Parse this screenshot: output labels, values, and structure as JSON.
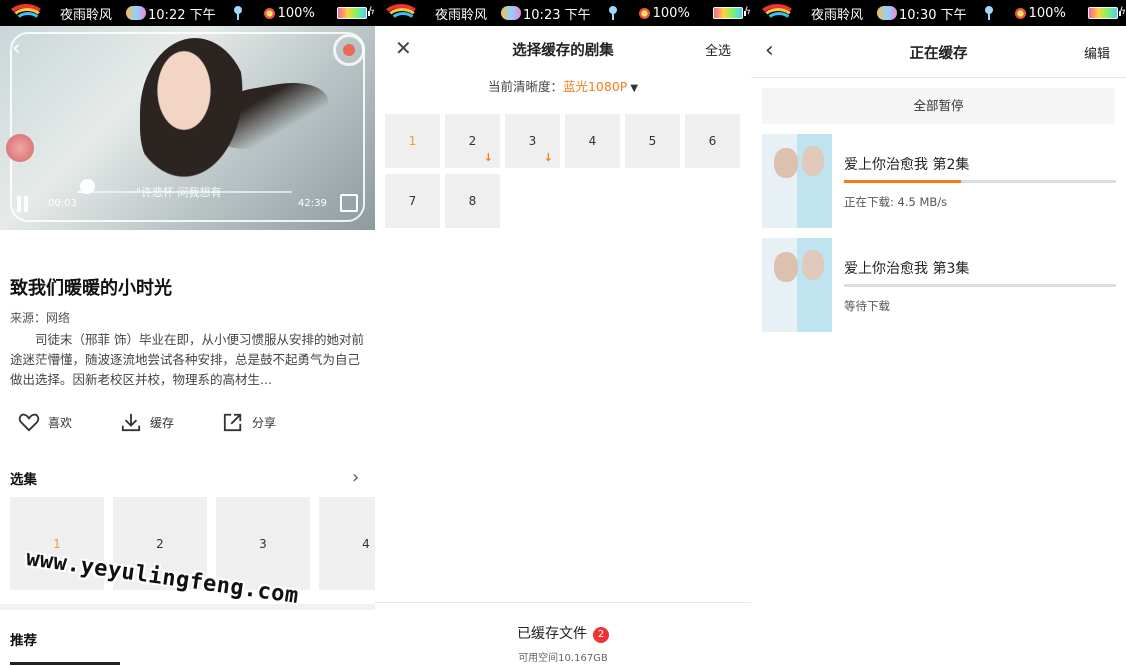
{
  "status_bars": [
    {
      "nick": "夜雨聆风",
      "time": "10:22 下午",
      "battery": "100%"
    },
    {
      "nick": "夜雨聆风",
      "time": "10:23 下午",
      "battery": "100%"
    },
    {
      "nick": "夜雨聆风",
      "time": "10:30 下午",
      "battery": "100%"
    }
  ],
  "detail": {
    "video": {
      "subtitle": "\"许悲怀  问我想有",
      "current_time": "00:03",
      "total_time": "42:39",
      "progress_fraction": 0.04
    },
    "title": "致我们暖暖的小时光",
    "source": "来源：网络",
    "description": "司徒末（邢菲 饰）毕业在即，从小便习惯服从安排的她对前途迷茫懵懂，随波逐流地尝试各种安排，总是鼓不起勇气为自己做出选择。因新老校区并校，物理系的高材生...",
    "actions": {
      "like": "喜欢",
      "cache": "缓存",
      "share": "分享"
    },
    "episodes_label": "选集",
    "episodes": [
      "1",
      "2",
      "3",
      "4"
    ],
    "selected_episode": "1",
    "recommend_label": "推荐",
    "watermark": "www.yeyulingfeng.com"
  },
  "cache_select": {
    "title": "选择缓存的剧集",
    "select_all": "全选",
    "quality_label": "当前清晰度：",
    "quality_value": "蓝光1080P",
    "episodes": [
      {
        "label": "1",
        "state": "selected"
      },
      {
        "label": "2",
        "state": "downloading"
      },
      {
        "label": "3",
        "state": "downloading"
      },
      {
        "label": "4",
        "state": "none"
      },
      {
        "label": "5",
        "state": "none"
      },
      {
        "label": "6",
        "state": "none"
      },
      {
        "label": "7",
        "state": "none"
      },
      {
        "label": "8",
        "state": "none"
      }
    ],
    "cached_files_label": "已缓存文件",
    "cached_count": "2",
    "available_space": "可用空间10.167GB"
  },
  "downloading": {
    "title": "正在缓存",
    "edit": "编辑",
    "pause_all": "全部暂停",
    "items": [
      {
        "name": "爱上你治愈我  第2集",
        "progress": 0.43,
        "status": "正在下载: 4.5 MB/s"
      },
      {
        "name": "爱上你治愈我  第3集",
        "progress": 0,
        "status": "等待下载"
      }
    ]
  },
  "colors": {
    "accent": "#f07e1e",
    "selected_text": "#f0a21a",
    "badge": "#ee3333"
  }
}
